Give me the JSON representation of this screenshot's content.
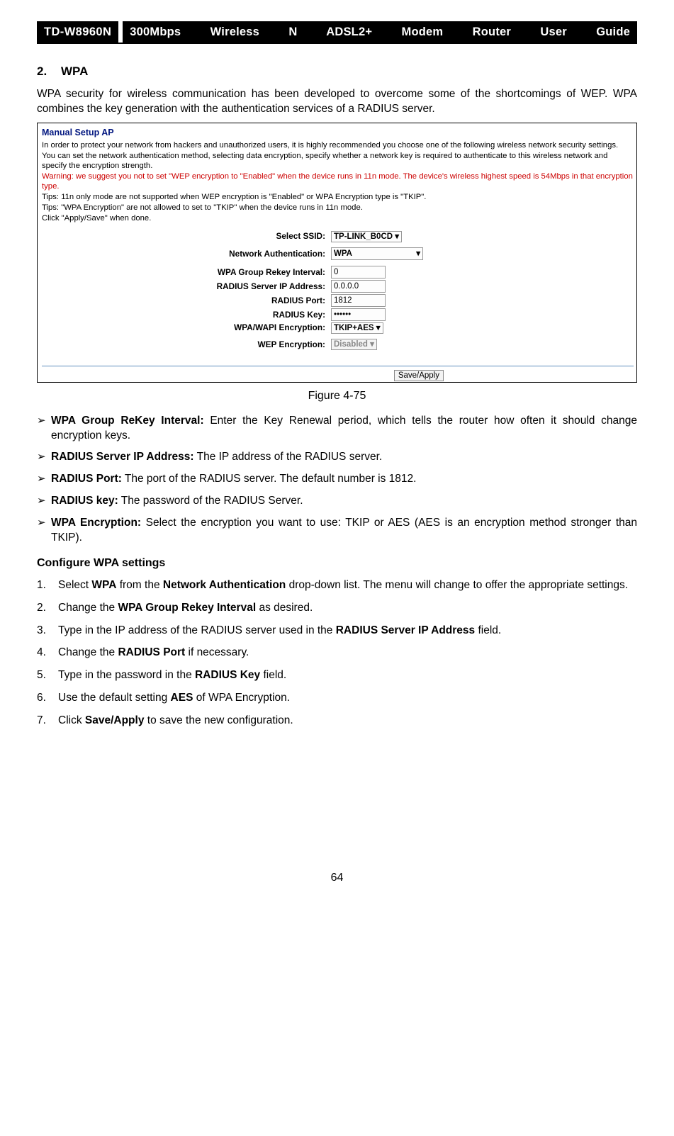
{
  "header": {
    "model": "TD-W8960N",
    "title": "300Mbps Wireless N ADSL2+ Modem Router User Guide"
  },
  "section": {
    "number": "2.",
    "title": "WPA"
  },
  "intro": "WPA security for wireless communication has been developed to overcome some of the shortcomings of WEP. WPA combines the key generation with the authentication services of a RADIUS server.",
  "figure": {
    "caption": "Figure 4-75",
    "title": "Manual Setup AP",
    "lines": {
      "l1": "In order to protect your network from hackers and unauthorized users, it is highly recommended you choose one of the following wireless network security settings.",
      "l2": "You can set the network authentication method, selecting data encryption, specify whether a network key is required to authenticate to this wireless network and specify the encryption strength.",
      "warn": "Warning: we suggest you not to set \"WEP encryption to \"Enabled\" when the device runs in 11n mode. The device's wireless highest speed is 54Mbps in that encryption type.",
      "tip1": "Tips: 11n only mode are not supported when WEP encryption is \"Enabled\" or WPA Encryption type is \"TKIP\".",
      "tip2": "Tips: \"WPA Encryption\" are not allowed to set to \"TKIP\" when the device runs in 11n mode.",
      "done": "Click \"Apply/Save\" when done."
    },
    "form": {
      "ssid_label": "Select SSID:",
      "ssid_value": "TP-LINK_B0CD",
      "auth_label": "Network Authentication:",
      "auth_value": "WPA",
      "rekey_label": "WPA Group Rekey Interval:",
      "rekey_value": "0",
      "radius_ip_label": "RADIUS Server IP Address:",
      "radius_ip_value": "0.0.0.0",
      "radius_port_label": "RADIUS Port:",
      "radius_port_value": "1812",
      "radius_key_label": "RADIUS Key:",
      "radius_key_value": "••••••",
      "wpa_enc_label": "WPA/WAPI Encryption:",
      "wpa_enc_value": "TKIP+AES",
      "wep_enc_label": "WEP Encryption:",
      "wep_enc_value": "Disabled",
      "save_button": "Save/Apply"
    }
  },
  "bullets": [
    {
      "label": "WPA Group ReKey Interval:",
      "text": " Enter the Key Renewal period, which tells the router how often it should change encryption keys."
    },
    {
      "label": "RADIUS Server IP Address:",
      "text": " The IP address of the RADIUS server."
    },
    {
      "label": "RADIUS Port:",
      "text": " The port of the RADIUS server. The default number is 1812."
    },
    {
      "label": "RADIUS key:",
      "text": " The password of the RADIUS Server."
    },
    {
      "label": "WPA Encryption:",
      "text": " Select the encryption you want to use: TKIP or AES (AES is an encryption method stronger than TKIP)."
    }
  ],
  "configure": {
    "heading": "Configure WPA settings",
    "steps": {
      "s1a": "Select ",
      "s1b": "WPA",
      "s1c": " from the ",
      "s1d": "Network Authentication",
      "s1e": " drop-down list. The menu will change to offer the appropriate settings.",
      "s2a": "Change the ",
      "s2b": "WPA Group Rekey Interval",
      "s2c": " as desired.",
      "s3a": "Type in the IP address of the RADIUS server used in the ",
      "s3b": "RADIUS Server IP Address",
      "s3c": " field.",
      "s4a": "Change the ",
      "s4b": "RADIUS Port",
      "s4c": " if necessary.",
      "s5a": "Type in the password in the ",
      "s5b": "RADIUS Key",
      "s5c": " field.",
      "s6a": "Use the default setting ",
      "s6b": "AES",
      "s6c": " of WPA Encryption.",
      "s7a": "Click ",
      "s7b": "Save/Apply",
      "s7c": " to save the new configuration."
    }
  },
  "page_number": "64"
}
